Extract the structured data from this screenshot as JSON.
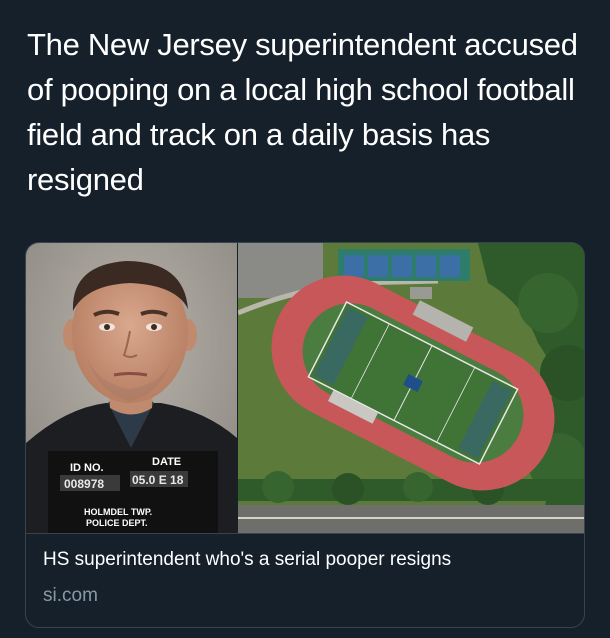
{
  "tweet": {
    "text": "The New Jersey superintendent accused of pooping on a local high school football field and track on a daily basis has resigned"
  },
  "link_card": {
    "title": "HS superintendent who's a serial pooper resigns",
    "domain": "si.com",
    "mugshot_board": {
      "id_label": "ID NO.",
      "date_label": "DATE",
      "id_value": "008978",
      "date_value": "05.0 E 18",
      "department_line1": "HOLMDEL TWP.",
      "department_line2": "POLICE DEPT."
    }
  },
  "colors": {
    "background": "#15202b",
    "border": "#38444d",
    "text": "#ffffff",
    "secondary_text": "#8899a6",
    "track": "#c8575a",
    "field": "#4a7d3f"
  }
}
